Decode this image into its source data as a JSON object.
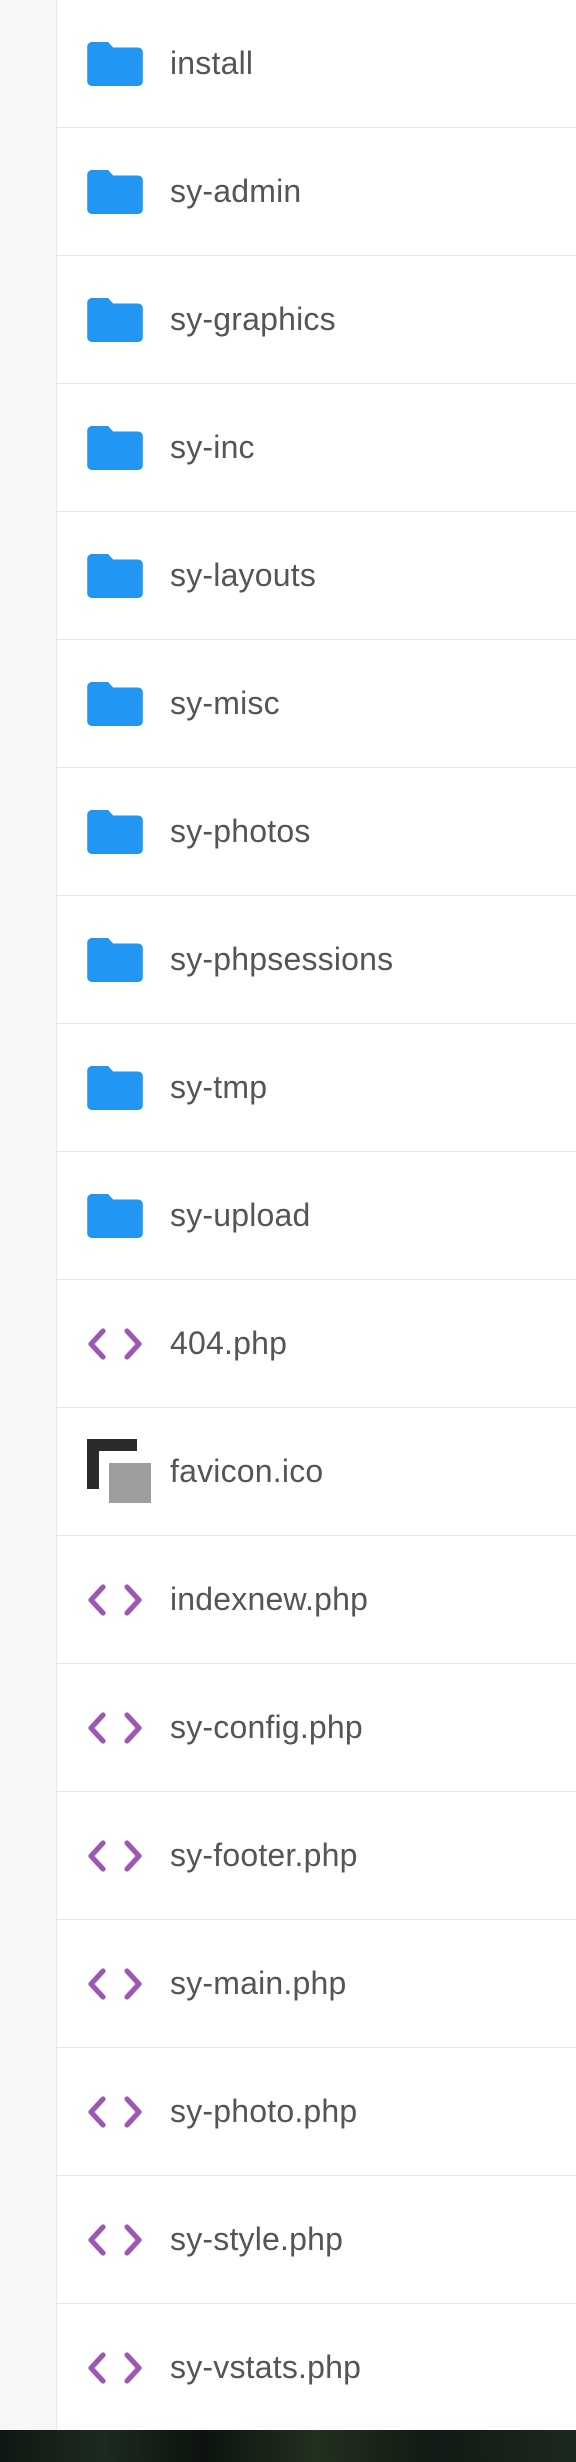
{
  "colors": {
    "folder": "#2196f3",
    "code": "#9b59b6",
    "gutter": "#f7f7f7",
    "text": "#555555"
  },
  "files": [
    {
      "name": "install",
      "type": "folder",
      "icon": "folder-icon"
    },
    {
      "name": "sy-admin",
      "type": "folder",
      "icon": "folder-icon"
    },
    {
      "name": "sy-graphics",
      "type": "folder",
      "icon": "folder-icon"
    },
    {
      "name": "sy-inc",
      "type": "folder",
      "icon": "folder-icon"
    },
    {
      "name": "sy-layouts",
      "type": "folder",
      "icon": "folder-icon"
    },
    {
      "name": "sy-misc",
      "type": "folder",
      "icon": "folder-icon"
    },
    {
      "name": "sy-photos",
      "type": "folder",
      "icon": "folder-icon"
    },
    {
      "name": "sy-phpsessions",
      "type": "folder",
      "icon": "folder-icon"
    },
    {
      "name": "sy-tmp",
      "type": "folder",
      "icon": "folder-icon"
    },
    {
      "name": "sy-upload",
      "type": "folder",
      "icon": "folder-icon"
    },
    {
      "name": "404.php",
      "type": "code",
      "icon": "code-icon"
    },
    {
      "name": "favicon.ico",
      "type": "image",
      "icon": "image-file-icon"
    },
    {
      "name": "indexnew.php",
      "type": "code",
      "icon": "code-icon"
    },
    {
      "name": "sy-config.php",
      "type": "code",
      "icon": "code-icon"
    },
    {
      "name": "sy-footer.php",
      "type": "code",
      "icon": "code-icon"
    },
    {
      "name": "sy-main.php",
      "type": "code",
      "icon": "code-icon"
    },
    {
      "name": "sy-photo.php",
      "type": "code",
      "icon": "code-icon"
    },
    {
      "name": "sy-style.php",
      "type": "code",
      "icon": "code-icon"
    },
    {
      "name": "sy-vstats.php",
      "type": "code",
      "icon": "code-icon"
    }
  ]
}
